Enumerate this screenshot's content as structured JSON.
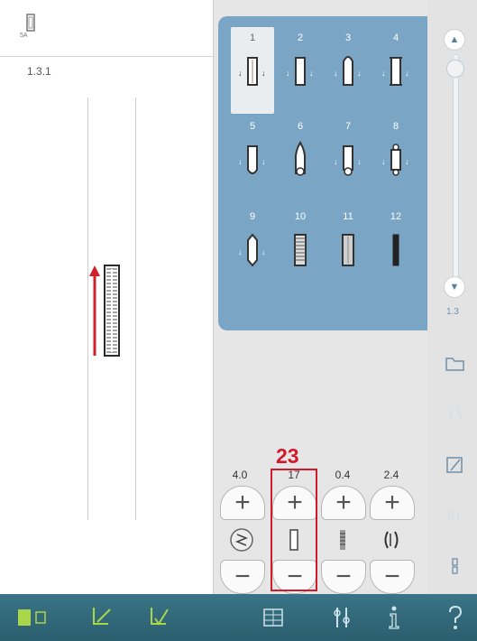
{
  "preview": {
    "stitch_id": "1.3.1"
  },
  "stitches": [
    {
      "number": "1",
      "selected": true
    },
    {
      "number": "2"
    },
    {
      "number": "3"
    },
    {
      "number": "4"
    },
    {
      "number": "5"
    },
    {
      "number": "6"
    },
    {
      "number": "7"
    },
    {
      "number": "8"
    },
    {
      "number": "9"
    },
    {
      "number": "10"
    },
    {
      "number": "11"
    },
    {
      "number": "12"
    }
  ],
  "scroll": {
    "label": "1.3",
    "up_icon": "up-arrow-icon",
    "down_icon": "down-arrow-icon"
  },
  "adjustments": [
    {
      "name": "width",
      "value": "4.0",
      "icon": "stitch-width-icon"
    },
    {
      "name": "length",
      "value": "17",
      "icon": "buttonhole-length-icon"
    },
    {
      "name": "density",
      "value": "0.4",
      "icon": "stitch-density-icon"
    },
    {
      "name": "cutting-space",
      "value": "2.4",
      "icon": "cutting-space-icon"
    }
  ],
  "annotation": {
    "label": "23"
  },
  "colors": {
    "accent": "#7aa5c4",
    "toolbar": "#2f6a7c",
    "highlight": "#d11a2a",
    "toolbar_icon": "#a9d64a"
  }
}
